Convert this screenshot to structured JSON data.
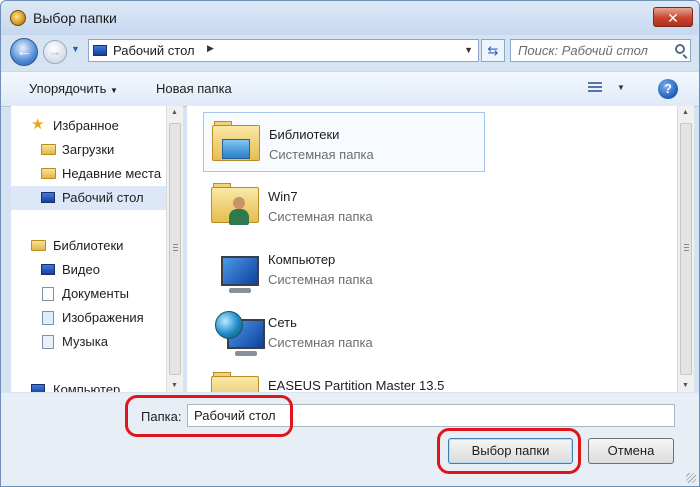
{
  "window": {
    "title": "Выбор папки",
    "close_glyph": "✕"
  },
  "nav": {
    "back_icon": "back-arrow-icon",
    "forward_icon": "forward-arrow-icon",
    "address": "Рабочий стол",
    "search_placeholder": "Поиск: Рабочий стол"
  },
  "toolbar": {
    "organize": "Упорядочить",
    "new_folder": "Новая папка",
    "help": "?"
  },
  "sidebar": {
    "items": [
      {
        "label": "Избранное",
        "icon": "star-icon"
      },
      {
        "label": "Загрузки",
        "icon": "downloads-folder-icon"
      },
      {
        "label": "Недавние места",
        "icon": "recent-places-icon"
      },
      {
        "label": "Рабочий стол",
        "icon": "desktop-icon",
        "selected": true
      },
      {
        "label": "Библиотеки",
        "icon": "libraries-icon"
      },
      {
        "label": "Видео",
        "icon": "video-icon"
      },
      {
        "label": "Документы",
        "icon": "documents-icon"
      },
      {
        "label": "Изображения",
        "icon": "pictures-icon"
      },
      {
        "label": "Музыка",
        "icon": "music-icon"
      },
      {
        "label": "Компьютер",
        "icon": "computer-icon"
      }
    ]
  },
  "content": {
    "items": [
      {
        "name": "Библиотеки",
        "type": "Системная папка",
        "icon": "libraries-folder-icon",
        "selected": true
      },
      {
        "name": "Win7",
        "type": "Системная папка",
        "icon": "user-folder-icon"
      },
      {
        "name": "Компьютер",
        "type": "Системная папка",
        "icon": "computer-icon"
      },
      {
        "name": "Сеть",
        "type": "Системная папка",
        "icon": "network-icon"
      },
      {
        "name": "EASEUS Partition Master 13.5",
        "type": "",
        "icon": "folder-icon"
      }
    ]
  },
  "bottom": {
    "folder_label": "Папка:",
    "folder_value": "Рабочий стол",
    "select_button": "Выбор папки",
    "cancel_button": "Отмена"
  },
  "colors": {
    "highlight": "#e0151b",
    "selection": "#dce8f8"
  }
}
